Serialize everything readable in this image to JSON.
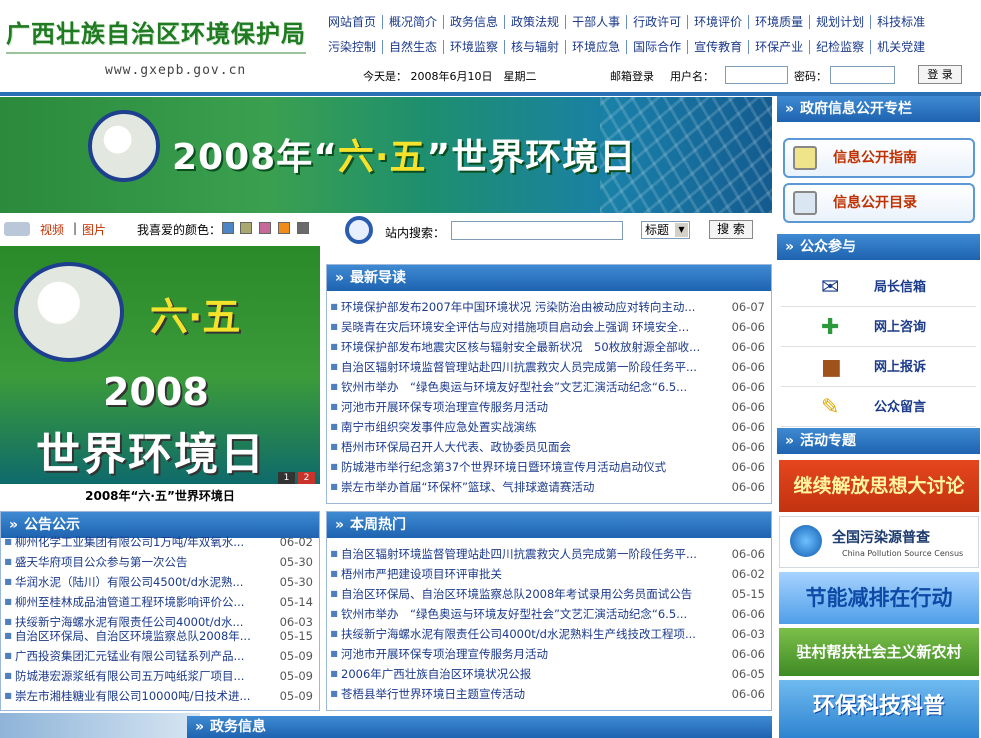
{
  "header": {
    "title": "广西壮族自治区环境保护局",
    "url": "www.gxepb.gov.cn",
    "nav_row1": [
      "网站首页",
      "概况简介",
      "政务信息",
      "政策法规",
      "干部人事",
      "行政许可",
      "环境评价",
      "环境质量",
      "规划计划",
      "科技标准"
    ],
    "nav_row2": [
      "污染控制",
      "自然生态",
      "环境监察",
      "核与辐射",
      "环境应急",
      "国际合作",
      "宣传教育",
      "环保产业",
      "纪检监察",
      "机关党建"
    ],
    "date_text": "今天是： 2008年6月10日　星期二",
    "mail_login": "邮箱登录",
    "user_label": "用户名：",
    "password_label": "密码：",
    "login_button": "登 录"
  },
  "banner": {
    "year_text": "2008年“",
    "highlight": "六·五",
    "suffix": "”世界环境日"
  },
  "tools": {
    "video": "视频",
    "separator": "|",
    "photo": "图片",
    "color_label": "我喜爱的颜色：",
    "swatches": [
      "#4c86c6",
      "#a8a870",
      "#c66a9a",
      "#f08c1a",
      "#6a6a6a"
    ],
    "search_label": "站内搜索：",
    "search_select": "标题",
    "search_button": "搜 索"
  },
  "feature": {
    "line1": "六·五",
    "line2": "2008",
    "line3": "世界环境日",
    "pager": [
      "1",
      "2"
    ],
    "caption": "2008年“六·五”世界环境日"
  },
  "latest": {
    "title": "最新导读",
    "items": [
      {
        "t": "环境保护部发布2007年中国环境状况 污染防治由被动应对转向主动...",
        "d": "06-07"
      },
      {
        "t": "吴晓青在灾后环境安全评估与应对措施项目启动会上强调 环境安全...",
        "d": "06-06"
      },
      {
        "t": "环境保护部发布地震灾区核与辐射安全最新状况　50枚放射源全部收...",
        "d": "06-06"
      },
      {
        "t": "自治区辐射环境监督管理站赴四川抗震救灾人员完成第一阶段任务平...",
        "d": "06-06"
      },
      {
        "t": "钦州市举办　“绿色奥运与环境友好型社会”文艺汇演活动纪念“6.5...",
        "d": "06-06"
      },
      {
        "t": "河池市开展环保专项治理宣传服务月活动",
        "d": "06-06"
      },
      {
        "t": "南宁市组织突发事件应急处置实战演练",
        "d": "06-06"
      },
      {
        "t": "梧州市环保局召开人大代表、政协委员见面会",
        "d": "06-06"
      },
      {
        "t": "防城港市举行纪念第37个世界环境日暨环境宣传月活动启动仪式",
        "d": "06-06"
      },
      {
        "t": "崇左市举办首届“环保杯”篮球、气排球邀请赛活动",
        "d": "06-06"
      }
    ]
  },
  "notice": {
    "title": "公告公示",
    "items": [
      {
        "t": "柳州化学工业集团有限公司1万吨/年双氧水...",
        "d": "06-02"
      },
      {
        "t": "盛天华府项目公众参与第一次公告",
        "d": "05-30"
      },
      {
        "t": "华润水泥（陆川）有限公司4500t/d水泥熟...",
        "d": "05-30"
      },
      {
        "t": "柳州至桂林成品油管道工程环境影响评价公...",
        "d": "05-14"
      },
      {
        "t": "扶绥新宁海螺水泥有限责任公司4000t/d水...",
        "d": "06-03"
      },
      {
        "t": "自治区环保局、自治区环境监察总队2008年...",
        "d": "05-15"
      },
      {
        "t": "广西投资集团汇元锰业有限公司锰系列产品...",
        "d": "05-09"
      },
      {
        "t": "防城港宏源浆纸有限公司五万吨纸浆厂项目...",
        "d": "05-09"
      },
      {
        "t": "崇左市湘桂糖业有限公司10000吨/日技术进...",
        "d": "05-09"
      }
    ]
  },
  "hot": {
    "title": "本周热门",
    "items": [
      {
        "t": "自治区辐射环境监督管理站赴四川抗震救灾人员完成第一阶段任务平...",
        "d": "06-06"
      },
      {
        "t": "梧州市严把建设项目环评审批关",
        "d": "06-02"
      },
      {
        "t": "自治区环保局、自治区环境监察总队2008年考试录用公务员面试公告",
        "d": "05-15"
      },
      {
        "t": "钦州市举办　“绿色奥运与环境友好型社会”文艺汇演活动纪念“6.5...",
        "d": "06-06"
      },
      {
        "t": "扶绥新宁海螺水泥有限责任公司4000t/d水泥熟料生产线技改工程项...",
        "d": "06-03"
      },
      {
        "t": "河池市开展环保专项治理宣传服务月活动",
        "d": "06-06"
      },
      {
        "t": "2006年广西壮族自治区环境状况公报",
        "d": "06-05"
      },
      {
        "t": "苍梧县举行世界环境日主题宣传活动",
        "d": "06-06"
      }
    ]
  },
  "gov": {
    "title": "政务信息"
  },
  "right": {
    "disclosure_title": "政府信息公开专栏",
    "disclosure_items": [
      "信息公开指南",
      "信息公开目录"
    ],
    "public_title": "公众参与",
    "public_items": [
      "局长信箱",
      "网上咨询",
      "网上报诉",
      "公众留言"
    ],
    "activity_title": "活动专题",
    "promos": [
      {
        "text": "继续解放思想大讨论",
        "sub": ""
      },
      {
        "text": "全国污染源普查",
        "sub": "China Pollution Source Census"
      },
      {
        "text": "节能减排在行动",
        "sub": ""
      },
      {
        "text": "驻村帮扶社会主义新农村",
        "sub": ""
      },
      {
        "text": "环保科技科普",
        "sub": ""
      }
    ]
  },
  "chevron": "»"
}
